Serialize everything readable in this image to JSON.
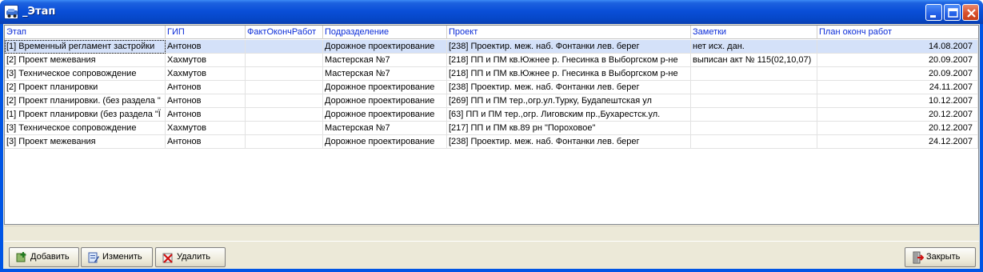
{
  "window": {
    "title": "_Этап",
    "minimize_icon": "minimize-icon",
    "maximize_icon": "maximize-icon",
    "close_icon": "close-icon"
  },
  "table": {
    "columns": [
      "Этап",
      "ГИП",
      "ФактОкончРабот",
      "Подразделение",
      "Проект",
      "Заметки",
      "План оконч работ"
    ],
    "rows": [
      [
        "[1] Временный регламент застройки",
        "Антонов",
        "",
        "Дорожное проектирование",
        "[238] Проектир. меж. наб. Фонтанки лев. берег",
        "нет исх. дан.",
        "14.08.2007"
      ],
      [
        "[2] Проект межевания",
        "Хахмутов",
        "",
        "Мастерская №7",
        "[218] ПП и ПМ кв.Южнее р. Гнесинка в Выборгском р-не",
        "выписан акт № 115(02,10,07)",
        "20.09.2007"
      ],
      [
        "[3] Техническое сопровождение",
        "Хахмутов",
        "",
        "Мастерская №7",
        "[218] ПП и ПМ кв.Южнее р. Гнесинка в Выборгском р-не",
        "",
        "20.09.2007"
      ],
      [
        "[2] Проект планировки",
        "Антонов",
        "",
        "Дорожное проектирование",
        "[238] Проектир. меж. наб. Фонтанки лев. берег",
        "",
        "24.11.2007"
      ],
      [
        "[2] Проект планировки. (без раздела \"",
        "Антонов",
        "",
        "Дорожное проектирование",
        "[269] ПП и ПМ тер.,огр.ул.Турку, Будапештская ул",
        "",
        "10.12.2007"
      ],
      [
        "[1] Проект планировки (без раздела \"Ї",
        "Антонов",
        "",
        "Дорожное проектирование",
        "[63] ПП и ПМ тер.,огр. Лиговским пр.,Бухарестск.ул.",
        "",
        "20.12.2007"
      ],
      [
        "[3] Техническое сопровождение",
        "Хахмутов",
        "",
        "Мастерская №7",
        "[217] ПП и ПМ кв.89 рн \"Пороховое\"",
        "",
        "20.12.2007"
      ],
      [
        "[3] Проект межевания",
        "Антонов",
        "",
        "Дорожное проектирование",
        "[238] Проектир. меж. наб. Фонтанки лев. берег",
        "",
        "24.12.2007"
      ]
    ],
    "selected_row": 0
  },
  "toolbar": {
    "add_label": "Добавить",
    "add_icon": "add-record-icon",
    "edit_label": "Изменить",
    "edit_icon": "edit-record-icon",
    "delete_label": "Удалить",
    "delete_icon": "delete-record-icon",
    "close_label": "Закрыть",
    "close_icon": "exit-door-icon"
  },
  "colors": {
    "titlebar": "#0a4fd8",
    "header_text": "#0b2cd8",
    "selected_row": "#d4e1f9",
    "face": "#ece9d8"
  }
}
